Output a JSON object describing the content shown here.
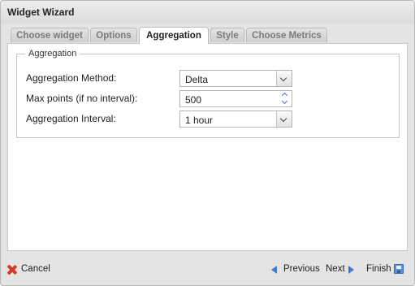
{
  "window": {
    "title": "Widget Wizard"
  },
  "tabs": [
    {
      "label": "Choose widget",
      "active": false
    },
    {
      "label": "Options",
      "active": false
    },
    {
      "label": "Aggregation",
      "active": true
    },
    {
      "label": "Style",
      "active": false
    },
    {
      "label": "Choose Metrics",
      "active": false
    }
  ],
  "aggregation": {
    "legend": "Aggregation",
    "method_label": "Aggregation Method:",
    "method_value": "Delta",
    "max_points_label": "Max points (if no interval):",
    "max_points_value": "500",
    "interval_label": "Aggregation Interval:",
    "interval_value": "1 hour"
  },
  "footer": {
    "cancel_label": "Cancel",
    "previous_label": "Previous",
    "next_label": "Next",
    "finish_label": "Finish"
  },
  "icons": {
    "cancel": "close-icon",
    "previous": "arrow-left-icon",
    "next": "arrow-right-icon",
    "finish": "save-icon"
  },
  "colors": {
    "cancel_icon": "#d53a2a",
    "nav_icon": "#3d7ad6",
    "active_tab": "#ffffff"
  }
}
